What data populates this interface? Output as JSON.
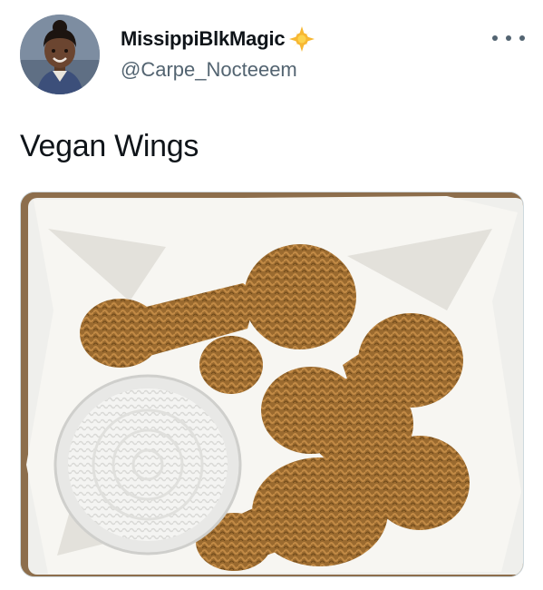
{
  "tweet": {
    "author": {
      "display_name": "MissippiBlkMagic",
      "name_emoji": "sun-emoji",
      "handle": "@Carpe_Nocteeem",
      "avatar_icon": "child-portrait-avatar"
    },
    "more_icon": "more-horizontal-icon",
    "text": "Vegan Wings",
    "media": {
      "description_icon": "crochet-chicken-wings-photo"
    }
  },
  "colors": {
    "text_primary": "#0f1419",
    "text_secondary": "#536471",
    "border": "#cfd9de",
    "emoji_sun": "#f7b731"
  }
}
